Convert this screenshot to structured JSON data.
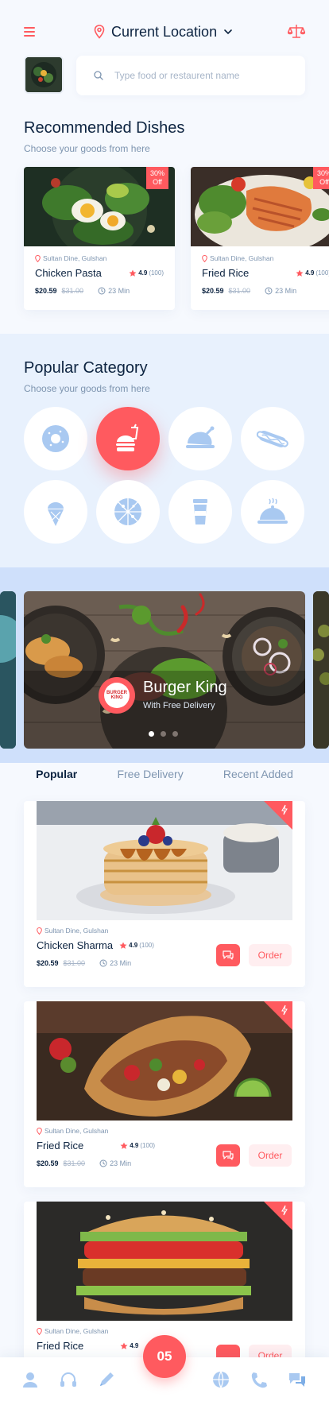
{
  "header": {
    "location_label": "Current Location",
    "menu_icon": "hamburger-icon",
    "scale_icon": "scale-icon"
  },
  "search": {
    "placeholder": "Type food or restaurent name"
  },
  "recommended": {
    "title": "Recommended Dishes",
    "subtitle": "Choose your goods from here",
    "items": [
      {
        "restaurant": "Sultan Dine, Gulshan",
        "name": "Chicken Pasta",
        "rating": "4.9",
        "reviews": "(100)",
        "price": "$20.59",
        "old_price": "$31.00",
        "time": "23 Min",
        "discount_pct": "30%",
        "discount_off": "Off"
      },
      {
        "restaurant": "Sultan Dine, Gulshan",
        "name": "Fried Rice",
        "rating": "4.9",
        "reviews": "(100)",
        "price": "$20.59",
        "old_price": "$31.00",
        "time": "23 Min",
        "discount_pct": "30%",
        "discount_off": "Off"
      }
    ]
  },
  "category": {
    "title": "Popular Category",
    "subtitle": "Choose your goods from here",
    "icons": [
      "donut-icon",
      "burger-combo-icon",
      "chicken-icon",
      "hotdog-icon",
      "ice-cream-icon",
      "pizza-icon",
      "drink-cup-icon",
      "cloche-icon"
    ],
    "active_index": 1
  },
  "banner": {
    "title": "Burger King",
    "subtitle": "With Free Delivery",
    "logo_text": "BURGER KING",
    "active_dot": 0,
    "dot_count": 3
  },
  "tabs": [
    "Popular",
    "Free Delivery",
    "Recent Added"
  ],
  "active_tab": 0,
  "popular": [
    {
      "restaurant": "Sultan Dine, Gulshan",
      "name": "Chicken Sharma",
      "rating": "4.9",
      "reviews": "(100)",
      "price": "$20.59",
      "old_price": "$31.00",
      "time": "23 Min",
      "order_label": "Order"
    },
    {
      "restaurant": "Sultan Dine, Gulshan",
      "name": "Fried Rice",
      "rating": "4.9",
      "reviews": "(100)",
      "price": "$20.59",
      "old_price": "$31.00",
      "time": "23 Min",
      "order_label": "Order"
    },
    {
      "restaurant": "Sultan Dine, Gulshan",
      "name": "Fried Rice",
      "rating": "4.9",
      "order_label": "Order"
    }
  ],
  "bottom_nav": {
    "cart_count": "05",
    "icons": [
      "user-icon",
      "headphones-icon",
      "pen-icon",
      "globe-icon",
      "phone-icon",
      "chat-icon"
    ]
  },
  "colors": {
    "accent": "#ff5a5f",
    "navy": "#0c2340",
    "muted": "#7e95b0",
    "soft_blue": "#e8f1fd"
  }
}
